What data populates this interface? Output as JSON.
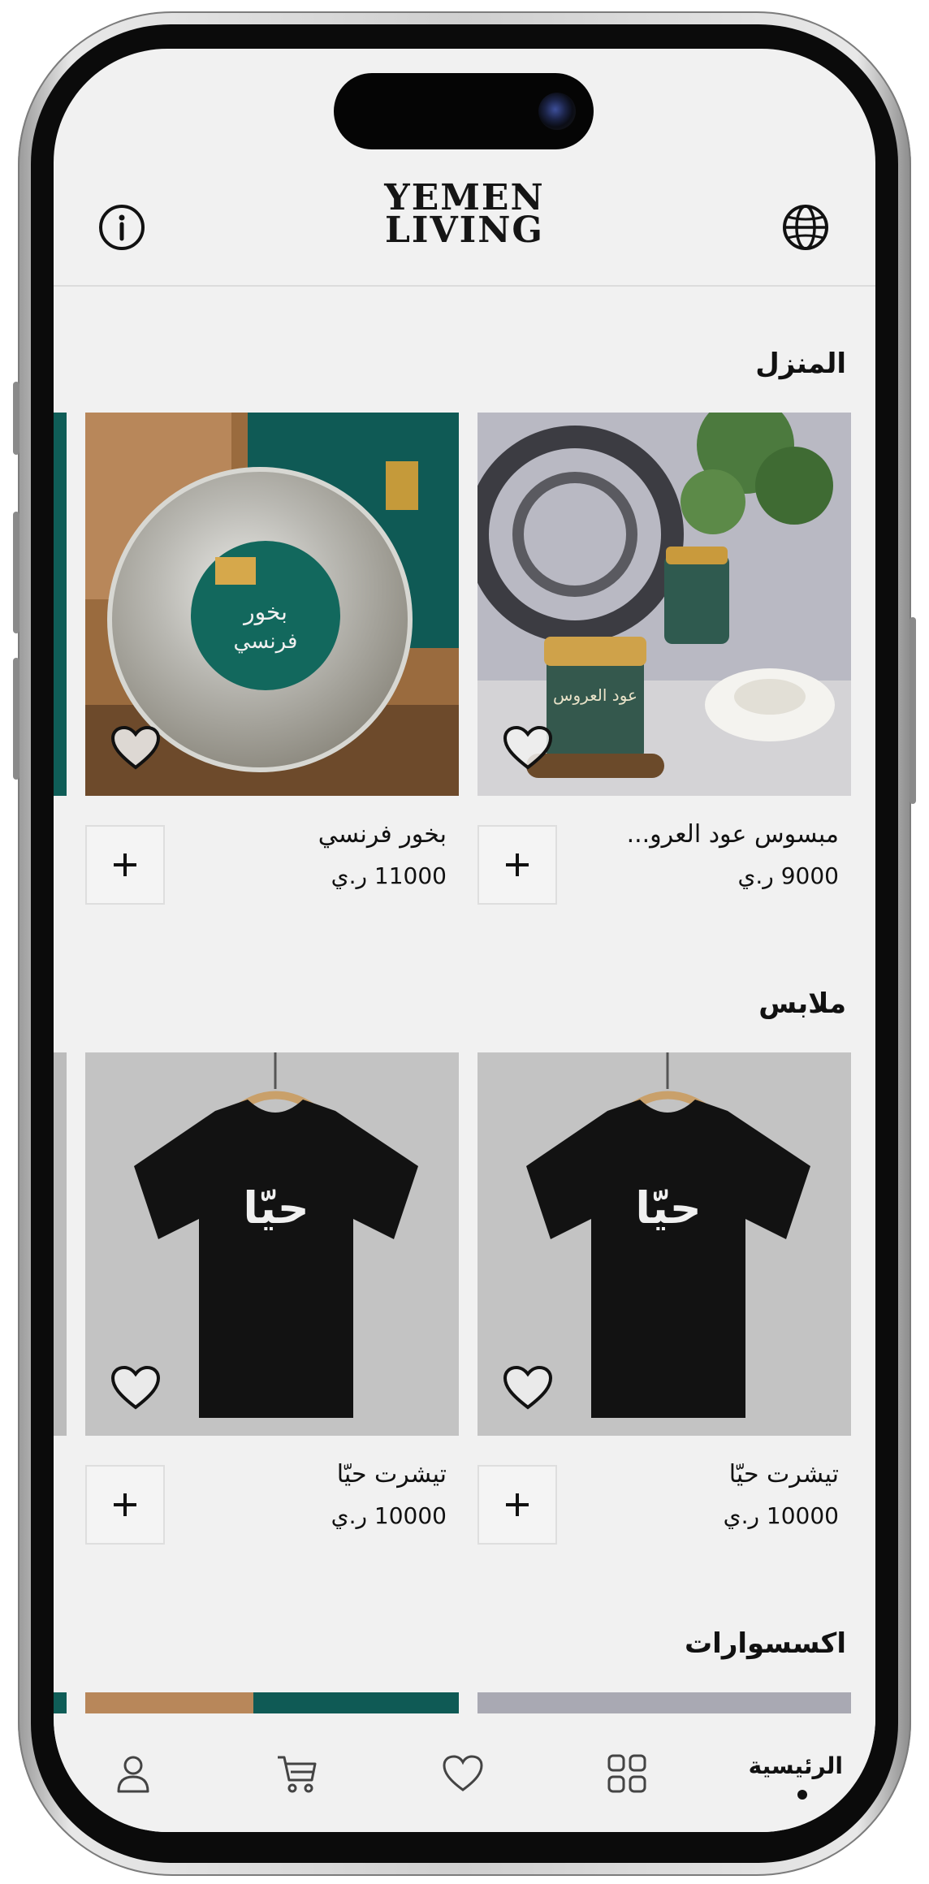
{
  "header": {
    "logo_line1": "YEMEN",
    "logo_line2": "LIVING",
    "left_icon": "info-icon",
    "right_icon": "globe-icon"
  },
  "sections": [
    {
      "title": "المنزل",
      "products": [
        {
          "name": "مبسوس عود العرو...",
          "price": "9000 ر.ي",
          "image": "ouda-jar-photo"
        },
        {
          "name": "بخور فرنسي",
          "price": "11000 ر.ي",
          "image": "ouda-foil-incense-photo"
        }
      ]
    },
    {
      "title": "ملابس",
      "products": [
        {
          "name": "تيشرت حيّا",
          "price": "10000 ر.ي",
          "image": "black-tshirt-photo",
          "tshirt_text": "حيّا"
        },
        {
          "name": "تيشرت حيّا",
          "price": "10000 ر.ي",
          "image": "black-tshirt-photo",
          "tshirt_text": "حيّا"
        }
      ]
    },
    {
      "title": "اكسسوارات"
    }
  ],
  "bottom_nav": {
    "home_label": "الرئيسية",
    "items": [
      "home",
      "categories-icon",
      "heart-icon",
      "cart-icon",
      "user-icon"
    ]
  },
  "colors": {
    "screen_bg": "#f1f1f1",
    "text": "#111111",
    "jar_green": "#2f5a4f",
    "foil_teal": "#1f6b5e"
  }
}
